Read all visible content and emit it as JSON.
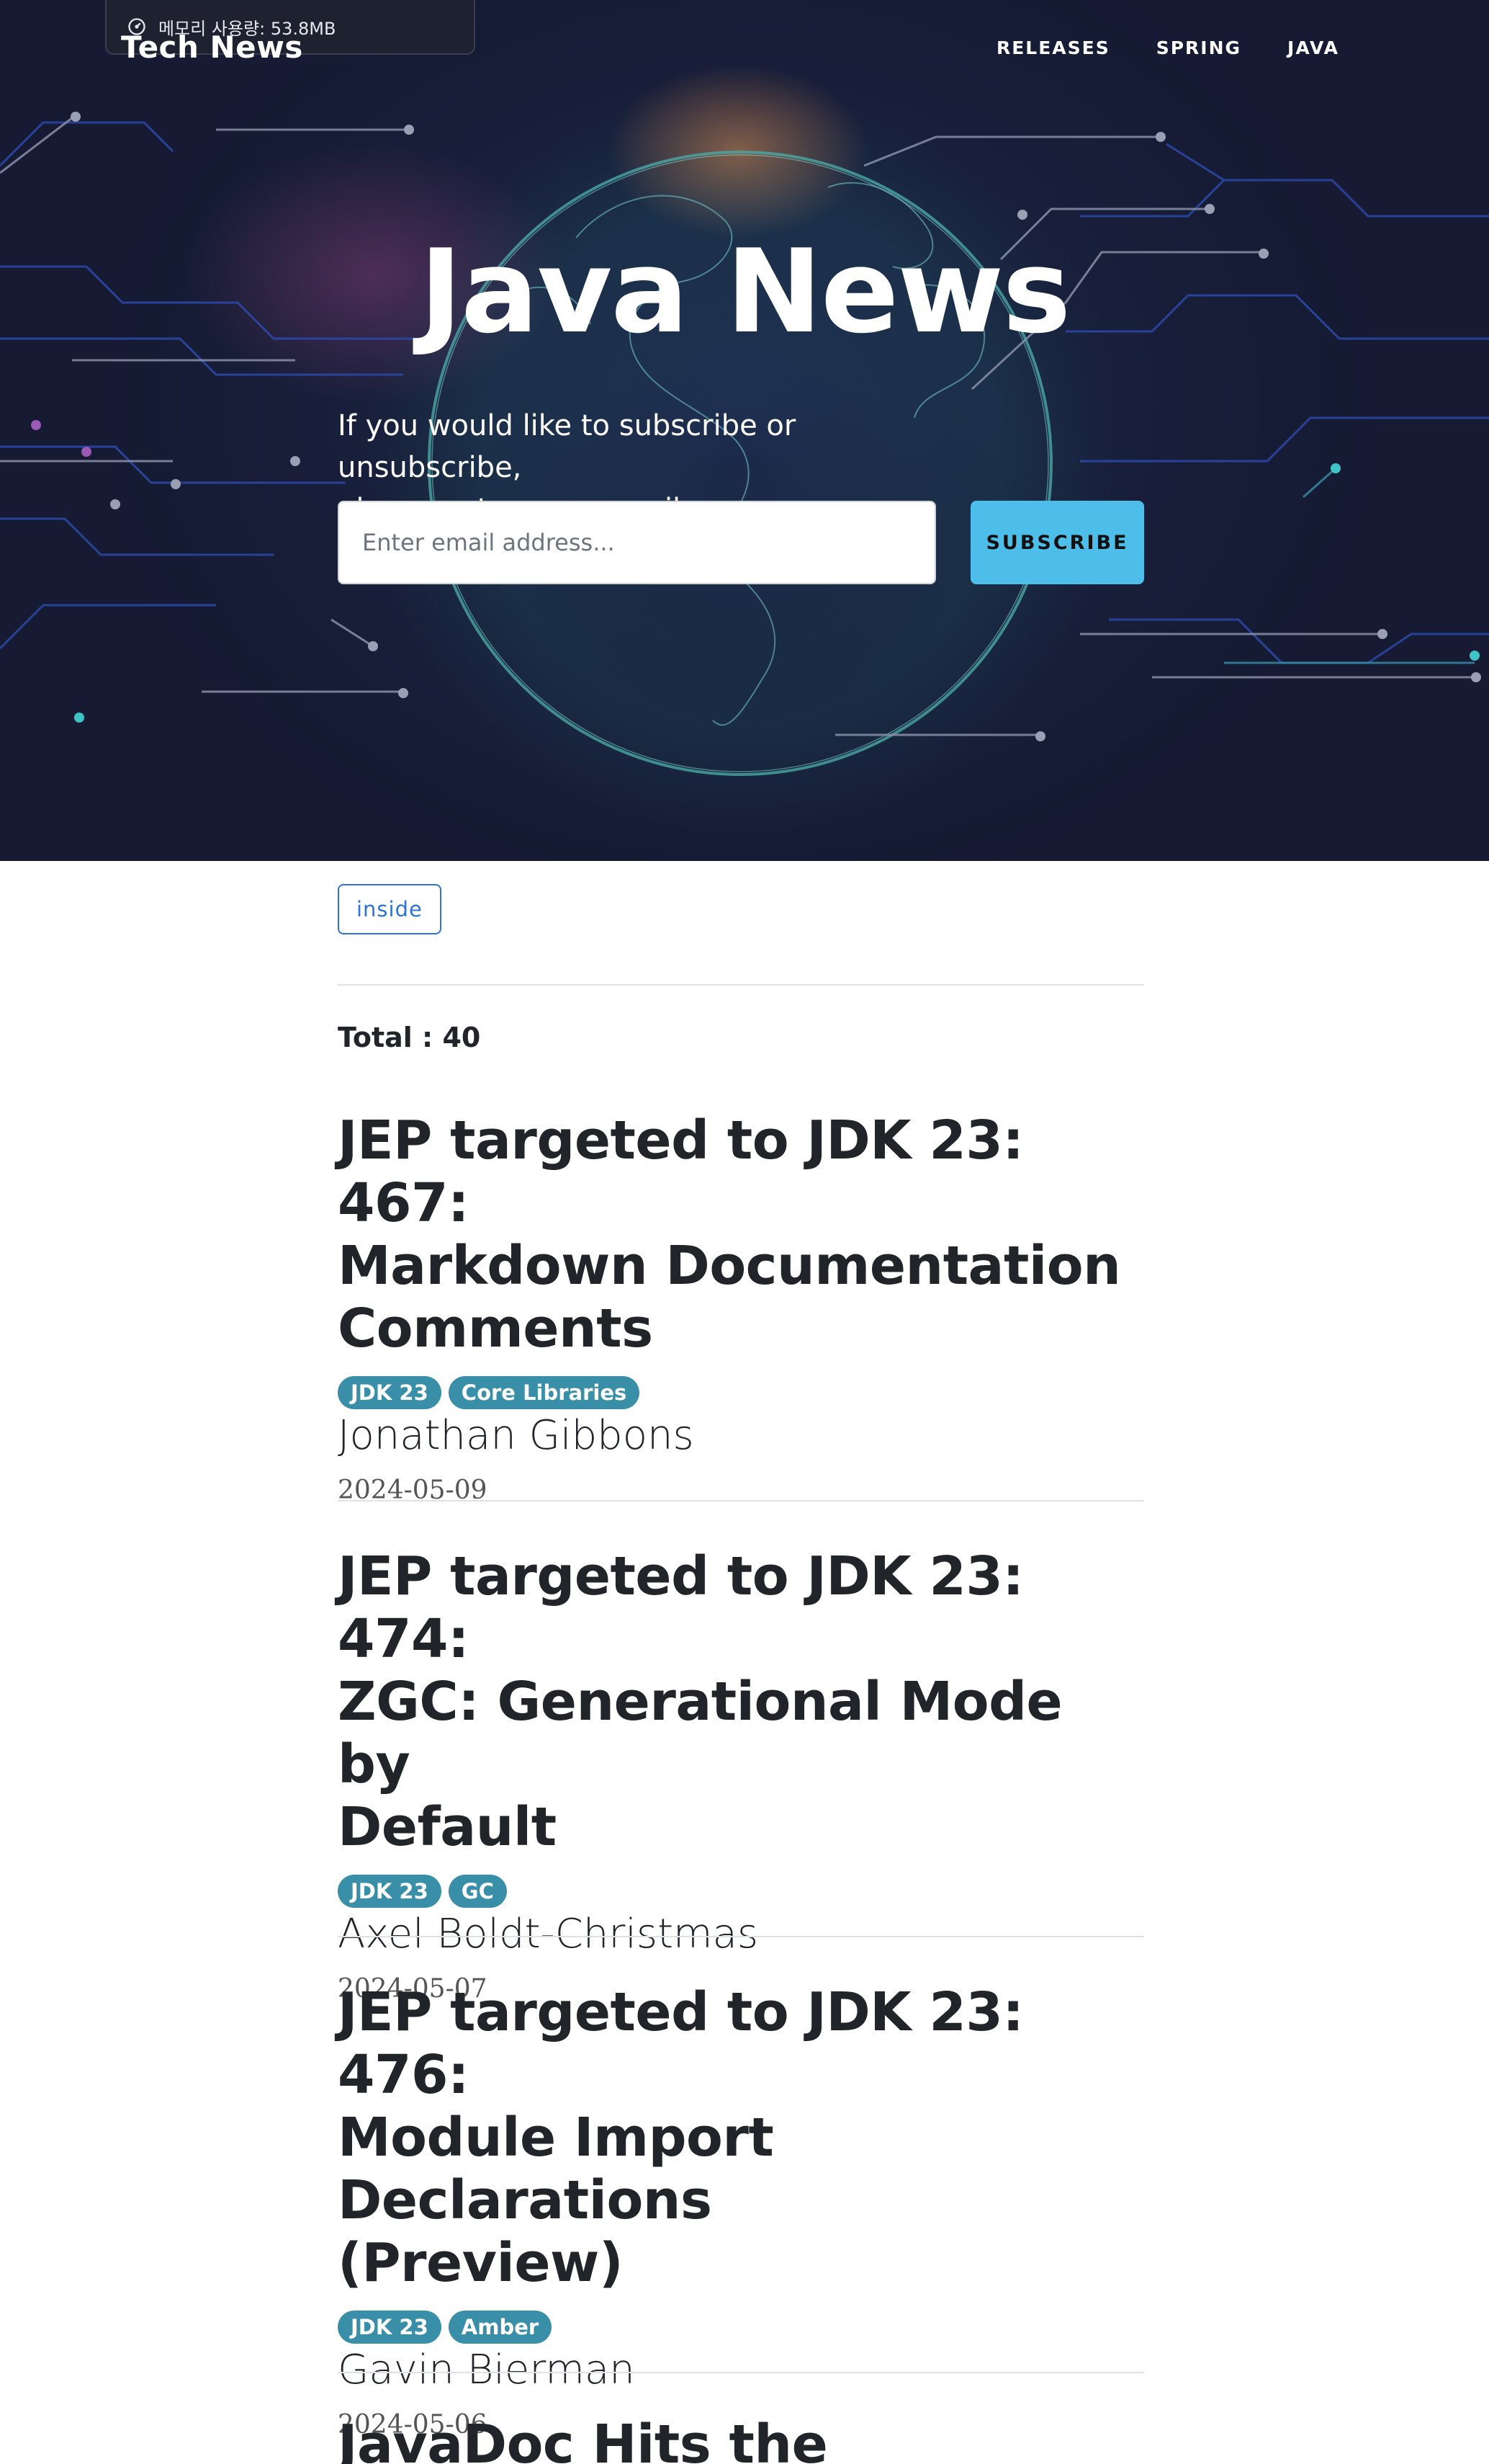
{
  "memory": {
    "label": "메모리 사용량: 53.8MB"
  },
  "brand": {
    "name": "Tech News"
  },
  "nav": {
    "items": [
      "RELEASES",
      "SPRING",
      "JAVA"
    ]
  },
  "hero": {
    "title": "Java News",
    "subtitle_line1": "If you would like to subscribe or unsubscribe,",
    "subtitle_line2": "please enter your email.",
    "email_placeholder": "Enter email address...",
    "subscribe_label": "SUBSCRIBE"
  },
  "filter": {
    "label": "inside"
  },
  "total": {
    "label": "Total : 40"
  },
  "colors": {
    "accent": "#4dbde9",
    "tag": "#3a8fa8",
    "filter": "#2f73d6",
    "hero_bg": "#161a33"
  },
  "posts": [
    {
      "title_lines": [
        "JEP targeted to JDK 23: 467:",
        "Markdown Documentation",
        "Comments"
      ],
      "tags": [
        "JDK 23",
        "Core Libraries"
      ],
      "author": "Jonathan Gibbons",
      "date": "2024-05-09"
    },
    {
      "title_lines": [
        "JEP targeted to JDK 23: 474:",
        "ZGC: Generational Mode by",
        "Default"
      ],
      "tags": [
        "JDK 23",
        "GC"
      ],
      "author": "Axel Boldt-Christmas",
      "date": "2024-05-07"
    },
    {
      "title_lines": [
        "JEP targeted to JDK 23: 476:",
        "Module Import Declarations",
        "(Preview)"
      ],
      "tags": [
        "JDK 23",
        "Amber"
      ],
      "author": "Gavin Bierman",
      "date": "2024-05-06"
    },
    {
      "title_lines": [
        "JavaDoc Hits the Markdown"
      ],
      "tags": [],
      "author": "",
      "date": ""
    }
  ]
}
